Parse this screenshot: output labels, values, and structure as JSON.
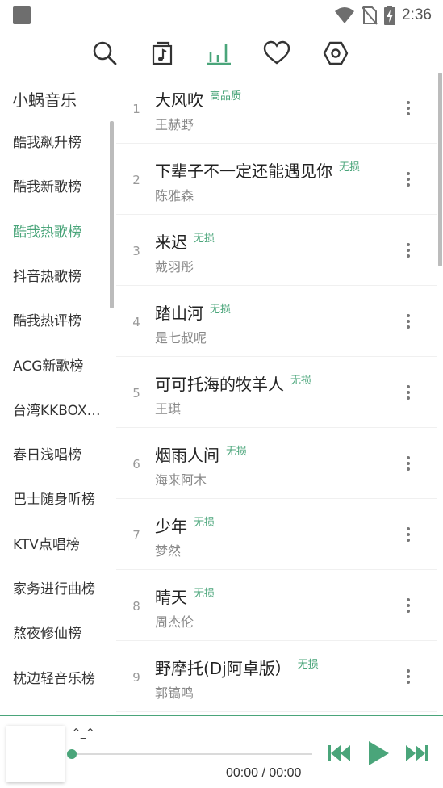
{
  "status_bar": {
    "time": "2:36"
  },
  "toolbar": {
    "icons": [
      "search-icon",
      "music-note-icon",
      "leaderboard-icon",
      "heart-icon",
      "settings-icon"
    ],
    "active_color": "#4aa57a"
  },
  "sidebar": {
    "title": "小蜗音乐",
    "items": [
      {
        "label": "酷我飙升榜"
      },
      {
        "label": "酷我新歌榜"
      },
      {
        "label": "酷我热歌榜",
        "active": true
      },
      {
        "label": "抖音热歌榜"
      },
      {
        "label": "酷我热评榜"
      },
      {
        "label": "ACG新歌榜"
      },
      {
        "label": "台湾KKBOX…"
      },
      {
        "label": "春日浅唱榜"
      },
      {
        "label": "巴士随身听榜"
      },
      {
        "label": "KTV点唱榜"
      },
      {
        "label": "家务进行曲榜"
      },
      {
        "label": "熬夜修仙榜"
      },
      {
        "label": "枕边轻音乐榜"
      }
    ]
  },
  "songs": [
    {
      "num": "1",
      "title": "大风吹",
      "badge": "高品质",
      "artist": "王赫野"
    },
    {
      "num": "2",
      "title": "下辈子不一定还能遇见你",
      "badge": "无损",
      "artist": "陈雅森"
    },
    {
      "num": "3",
      "title": "来迟",
      "badge": "无损",
      "artist": "戴羽彤"
    },
    {
      "num": "4",
      "title": "踏山河",
      "badge": "无损",
      "artist": "是七叔呢"
    },
    {
      "num": "5",
      "title": "可可托海的牧羊人",
      "badge": "无损",
      "artist": "王琪"
    },
    {
      "num": "6",
      "title": "烟雨人间",
      "badge": "无损",
      "artist": "海来阿木"
    },
    {
      "num": "7",
      "title": "少年",
      "badge": "无损",
      "artist": "梦然"
    },
    {
      "num": "8",
      "title": "晴天",
      "badge": "无损",
      "artist": "周杰伦"
    },
    {
      "num": "9",
      "title": "野摩托(Dj阿卓版）",
      "badge": "无损",
      "artist": "郭镐鸣"
    }
  ],
  "player": {
    "title": "^_^",
    "time": "00:00 / 00:00",
    "progress": 0,
    "accent": "#4aa57a"
  }
}
